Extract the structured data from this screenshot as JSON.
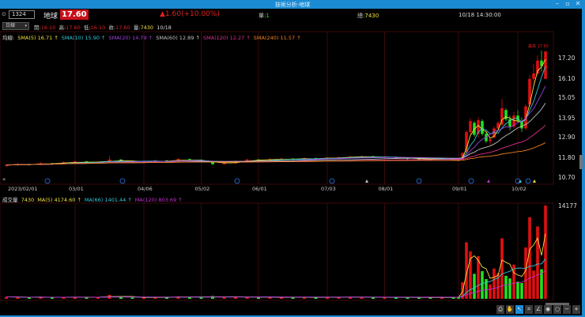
{
  "window": {
    "title": "技術分析-地球",
    "controls": [
      "–",
      "▫",
      "✕"
    ]
  },
  "header": {
    "code": "1324",
    "name": "地球",
    "price": "17.60",
    "change": "▲1.60(+10.00%)",
    "single_label": "單:",
    "single_value": "1",
    "total_label": "總:",
    "total_value": "7430",
    "datetime": "10/18 14:30:00"
  },
  "ohlc_row": {
    "period": "日線",
    "open_label": "開:",
    "open": "16.10",
    "high_label": "高:",
    "high": "17.60",
    "low_label": "低:",
    "low": "16.10",
    "close_label": "收:",
    "close": "17.60",
    "vol_label": "量:",
    "vol": "7430",
    "date": "10/18"
  },
  "ma_legend": {
    "label": "均線:",
    "items": [
      {
        "text": "SMA(5) 16.71 ↑",
        "color": "#f0e040"
      },
      {
        "text": "SMA(10) 15.90 ↑",
        "color": "#30c8d8"
      },
      {
        "text": "SMA(20) 14.79 ↑",
        "color": "#a040e0"
      },
      {
        "text": "SMA(60) 12.89 ↑",
        "color": "#c0c0c0"
      },
      {
        "text": "SMA(120) 12.27 ↑",
        "color": "#e03090"
      },
      {
        "text": "SMA(240) 11.57 ↑",
        "color": "#f08020"
      }
    ]
  },
  "vol_legend": {
    "label": "成交量",
    "value": "7430",
    "items": [
      {
        "text": "MA(5) 4174.60 ↑",
        "color": "#f0e040"
      },
      {
        "text": "MA(66) 1401.44 ↑",
        "color": "#30c8d8"
      },
      {
        "text": "MA(120) 803.69 ↑",
        "color": "#c030d0"
      }
    ]
  },
  "high_marker": "最高 17.65",
  "colors": {
    "up": "#e01010",
    "down": "#20e020",
    "grid": "#3a0a0a",
    "accent": "#1b8bd3"
  },
  "chart_data": {
    "type": "candlestick",
    "price_axis": {
      "ticks": [
        "17.20",
        "16.10",
        "15.05",
        "13.95",
        "12.90",
        "11.80",
        "10.70"
      ],
      "range": [
        10.7,
        17.65
      ]
    },
    "volume_axis": {
      "ticks": [
        "14177"
      ],
      "max": 14177
    },
    "x_ticks": [
      {
        "label": "2023/02/01",
        "index": 0
      },
      {
        "label": "03/01",
        "index": 6
      },
      {
        "label": "04/06",
        "index": 12
      },
      {
        "label": "05/02",
        "index": 17
      },
      {
        "label": "06/01",
        "index": 22
      },
      {
        "label": "07/03",
        "index": 28
      },
      {
        "label": "08/01",
        "index": 33
      },
      {
        "label": "09/01",
        "index": 40
      },
      {
        "label": "10/02",
        "index": 55
      }
    ],
    "candles_ohlcv": [
      [
        11.35,
        11.45,
        11.3,
        11.4,
        300
      ],
      [
        11.4,
        11.5,
        11.35,
        11.45,
        250
      ],
      [
        11.45,
        11.48,
        11.38,
        11.42,
        200
      ],
      [
        11.42,
        11.55,
        11.4,
        11.5,
        320
      ],
      [
        11.5,
        11.52,
        11.44,
        11.48,
        180
      ],
      [
        11.48,
        11.6,
        11.46,
        11.55,
        260
      ],
      [
        11.55,
        11.65,
        11.52,
        11.6,
        300
      ],
      [
        11.6,
        11.62,
        11.5,
        11.52,
        220
      ],
      [
        11.52,
        11.6,
        11.5,
        11.58,
        200
      ],
      [
        11.58,
        11.9,
        11.55,
        11.7,
        600
      ],
      [
        11.7,
        11.72,
        11.6,
        11.62,
        240
      ],
      [
        11.62,
        11.64,
        11.52,
        11.55,
        200
      ],
      [
        11.55,
        11.62,
        11.52,
        11.58,
        180
      ],
      [
        11.58,
        11.7,
        11.55,
        11.65,
        260
      ],
      [
        11.65,
        11.68,
        11.56,
        11.6,
        210
      ],
      [
        11.6,
        11.78,
        11.58,
        11.72,
        380
      ],
      [
        11.72,
        11.75,
        11.64,
        11.68,
        230
      ],
      [
        11.68,
        11.7,
        11.56,
        11.6,
        260
      ],
      [
        11.6,
        11.62,
        11.4,
        11.45,
        420
      ],
      [
        11.45,
        11.55,
        11.42,
        11.5,
        260
      ],
      [
        11.5,
        11.66,
        11.48,
        11.62,
        300
      ],
      [
        11.62,
        11.74,
        11.6,
        11.7,
        280
      ],
      [
        11.7,
        11.72,
        11.62,
        11.66,
        200
      ],
      [
        11.66,
        11.76,
        11.64,
        11.72,
        250
      ],
      [
        11.72,
        11.8,
        11.7,
        11.75,
        230
      ],
      [
        11.75,
        11.77,
        11.66,
        11.7,
        210
      ],
      [
        11.7,
        11.82,
        11.68,
        11.78,
        260
      ],
      [
        11.78,
        11.8,
        11.7,
        11.74,
        190
      ],
      [
        11.74,
        11.84,
        11.72,
        11.8,
        240
      ],
      [
        11.8,
        11.86,
        11.76,
        11.82,
        260
      ],
      [
        11.82,
        11.9,
        11.8,
        11.85,
        280
      ],
      [
        11.85,
        11.92,
        11.82,
        11.88,
        250
      ],
      [
        11.88,
        11.9,
        11.78,
        11.8,
        230
      ],
      [
        11.8,
        11.86,
        11.78,
        11.84,
        210
      ],
      [
        11.84,
        11.86,
        11.74,
        11.78,
        220
      ],
      [
        11.78,
        11.8,
        11.7,
        11.75,
        240
      ],
      [
        11.75,
        11.78,
        11.68,
        11.72,
        200
      ],
      [
        11.72,
        11.74,
        11.66,
        11.7,
        190
      ],
      [
        11.7,
        11.78,
        11.68,
        11.74,
        230
      ],
      [
        11.74,
        11.76,
        11.64,
        11.68,
        210
      ],
      [
        11.68,
        11.7,
        11.62,
        11.65,
        300
      ],
      [
        11.7,
        12.1,
        11.68,
        12.05,
        2500
      ],
      [
        12.1,
        13.3,
        12.05,
        13.2,
        8600
      ],
      [
        13.2,
        13.95,
        13.0,
        13.8,
        7200
      ],
      [
        13.7,
        13.8,
        12.95,
        13.05,
        3800
      ],
      [
        13.1,
        14.0,
        12.9,
        13.85,
        6500
      ],
      [
        13.8,
        13.9,
        13.0,
        13.1,
        4200
      ],
      [
        13.1,
        13.2,
        12.6,
        12.7,
        3000
      ],
      [
        12.7,
        12.9,
        12.5,
        12.8,
        2200
      ],
      [
        12.9,
        13.5,
        12.85,
        13.4,
        4600
      ],
      [
        13.4,
        13.8,
        13.3,
        13.7,
        3900
      ],
      [
        13.6,
        15.0,
        13.5,
        14.5,
        9200
      ],
      [
        14.4,
        14.5,
        13.8,
        13.9,
        3500
      ],
      [
        13.9,
        14.1,
        13.3,
        13.5,
        3100
      ],
      [
        13.5,
        14.3,
        13.4,
        14.1,
        5200
      ],
      [
        14.1,
        14.4,
        13.7,
        13.8,
        2600
      ],
      [
        13.8,
        14.0,
        13.2,
        13.4,
        2400
      ],
      [
        13.4,
        14.7,
        13.3,
        14.6,
        7800
      ],
      [
        14.7,
        16.3,
        14.6,
        16.1,
        12400
      ],
      [
        16.1,
        16.9,
        15.9,
        16.4,
        4300
      ],
      [
        16.4,
        17.4,
        16.3,
        17.1,
        11000
      ],
      [
        17.1,
        17.65,
        16.5,
        16.8,
        4500
      ],
      [
        16.1,
        17.6,
        16.1,
        17.6,
        14177
      ]
    ]
  }
}
